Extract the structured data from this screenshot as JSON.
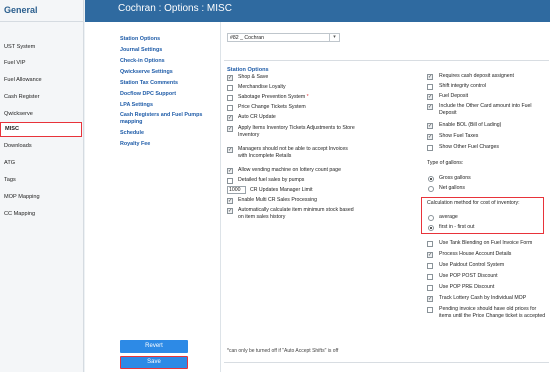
{
  "sidebar": {
    "title": "General",
    "items": [
      {
        "label": "UST System"
      },
      {
        "label": "Fuel VIP"
      },
      {
        "label": "Fuel Allowance"
      },
      {
        "label": "Cash Register"
      },
      {
        "label": "Qwickserve"
      },
      {
        "label": "MISC",
        "active": true
      },
      {
        "label": "Downloads"
      },
      {
        "label": "ATG"
      },
      {
        "label": "Tags"
      },
      {
        "label": "MOP Mapping"
      },
      {
        "label": "CC Mapping"
      }
    ]
  },
  "header": {
    "title": "Cochran : Options : MISC"
  },
  "left_nav": {
    "items": [
      {
        "label": "Station Options"
      },
      {
        "label": "Journal Settings"
      },
      {
        "label": "Check-in Options"
      },
      {
        "label": "Qwickserve Settings"
      },
      {
        "label": "Station Tax Comments"
      },
      {
        "label": "Docflow DPC Support"
      },
      {
        "label": "LPA Settings"
      },
      {
        "label": "Cash Registers and Fuel Pumps mapping"
      },
      {
        "label": "Schedule"
      },
      {
        "label": "Royalty Fee"
      }
    ],
    "revert_label": "Revert",
    "save_label": "Save"
  },
  "station_select": {
    "value": "#82 _ Cochran",
    "arrow": "▾"
  },
  "section_title": "Station Options",
  "left_options": [
    {
      "label": "Shop & Save",
      "checked": true
    },
    {
      "label": "Merchandise Loyalty",
      "checked": false
    },
    {
      "label": "Sabotage Prevention System",
      "required_mark": "*",
      "checked": false
    },
    {
      "label": "Price Change Tickets System",
      "checked": false
    },
    {
      "label": "Auto CR Update",
      "checked": true
    },
    {
      "label": "Apply Items Inventory Tickets Adjustments to Store Inventory",
      "checked": true
    },
    {
      "label": "Managers should not be able to accept Invoices with Incomplete Retails",
      "checked": true
    },
    {
      "label": "Allow vending machine on lottery count page",
      "checked": true
    },
    {
      "label": "Detailed fuel sales by pumps",
      "checked": false
    },
    {
      "label": "Enable Multi CR Sales Processing",
      "checked": true
    },
    {
      "label": "Automatically calculate item minimum stock based on item sales history",
      "checked": true
    }
  ],
  "cr_manager_limit": {
    "value": "1000",
    "label": "CR Updates Manager Limit"
  },
  "right_options_top": [
    {
      "label": "Requires cash deposit assignent",
      "checked": true
    },
    {
      "label": "Shift integrity control",
      "checked": false
    },
    {
      "label": "Fuel Deposit",
      "checked": true
    },
    {
      "label": "Include the Other Card amount into Fuel Deposit",
      "checked": true
    },
    {
      "label": "Enable BOL (Bill of Lading)",
      "checked": true
    },
    {
      "label": "Show Fuel Taxes",
      "checked": true
    },
    {
      "label": "Show Other Fuel Charges",
      "checked": false
    }
  ],
  "gallons": {
    "title": "Type of gallons:",
    "options": [
      {
        "label": "Gross gallons",
        "selected": true
      },
      {
        "label": "Net gallons",
        "selected": false
      }
    ]
  },
  "calc_method": {
    "title": "Calculation method for cost of inventory:",
    "options": [
      {
        "label": "average",
        "selected": false
      },
      {
        "label": "first in - first out",
        "selected": true
      }
    ]
  },
  "right_options_bottom": [
    {
      "label": "Use Tank Blending on Fuel Invoice Form",
      "checked": false
    },
    {
      "label": "Process House Account Details",
      "checked": true
    },
    {
      "label": "Use Paidout Control System",
      "checked": false
    },
    {
      "label": "Use POP POST Discount",
      "checked": false
    },
    {
      "label": "Use POP PRE Discount",
      "checked": false
    },
    {
      "label": "Track Lottery Cash by Individual MOP",
      "checked": true
    },
    {
      "label": "Pending invoice should have old prices for items until the Price Change ticket is accepted",
      "checked": false
    }
  ],
  "footnote": "*can only be turned off if \"Auto Accept Shifts\" is off",
  "check_glyph": "✓"
}
